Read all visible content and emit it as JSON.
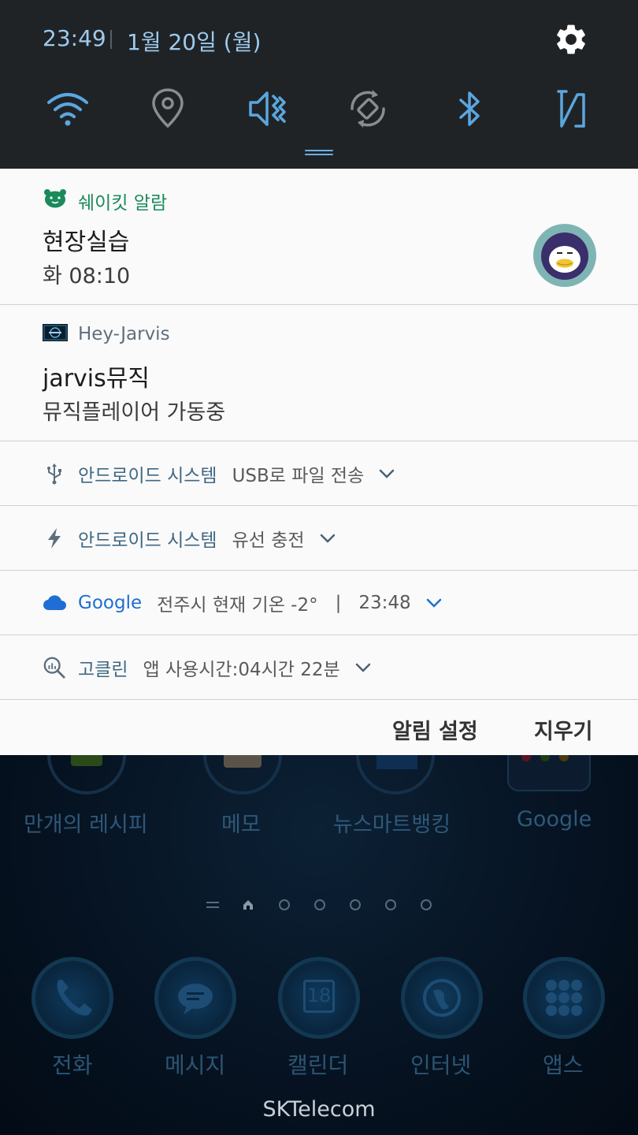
{
  "status": {
    "time": "23:49",
    "date": "1월 20일 (월)"
  },
  "quick_settings": {
    "toggles": [
      {
        "name": "wifi",
        "active": true
      },
      {
        "name": "location",
        "active": false
      },
      {
        "name": "sound",
        "active": true
      },
      {
        "name": "auto-rotate",
        "active": false
      },
      {
        "name": "bluetooth",
        "active": true
      },
      {
        "name": "nfc",
        "active": true
      }
    ]
  },
  "notifications": [
    {
      "app": "쉐이킷 알람",
      "title": "현장실습",
      "text": "화 08:10"
    },
    {
      "app": "Hey-Jarvis",
      "title": "jarvis뮤직",
      "text": "뮤직플레이어 가동중"
    }
  ],
  "compact_notifications": [
    {
      "app": "안드로이드 시스템",
      "text": "USB로 파일 전송"
    },
    {
      "app": "안드로이드 시스템",
      "text": "유선 충전"
    },
    {
      "app": "Google",
      "text": "전주시 현재 기온 -2°",
      "time": "23:48",
      "separator": "|"
    },
    {
      "app": "고클린",
      "text": "앱 사용시간:04시간 22분"
    }
  ],
  "actions": {
    "settings": "알림 설정",
    "clear": "지우기"
  },
  "home": {
    "apps": [
      "만개의 레시피",
      "메모",
      "뉴스마트뱅킹",
      "Google"
    ],
    "dock": [
      "전화",
      "메시지",
      "캘린더",
      "인터넷",
      "앱스"
    ],
    "calendar_day": "18",
    "carrier": "SKTelecom"
  },
  "colors": {
    "accent_blue": "#5aa7e0",
    "google_blue": "#1f6ed4",
    "shakeit_green": "#1b8a5a",
    "panel_bg": "#fafafa",
    "qs_bg": "#202326"
  }
}
